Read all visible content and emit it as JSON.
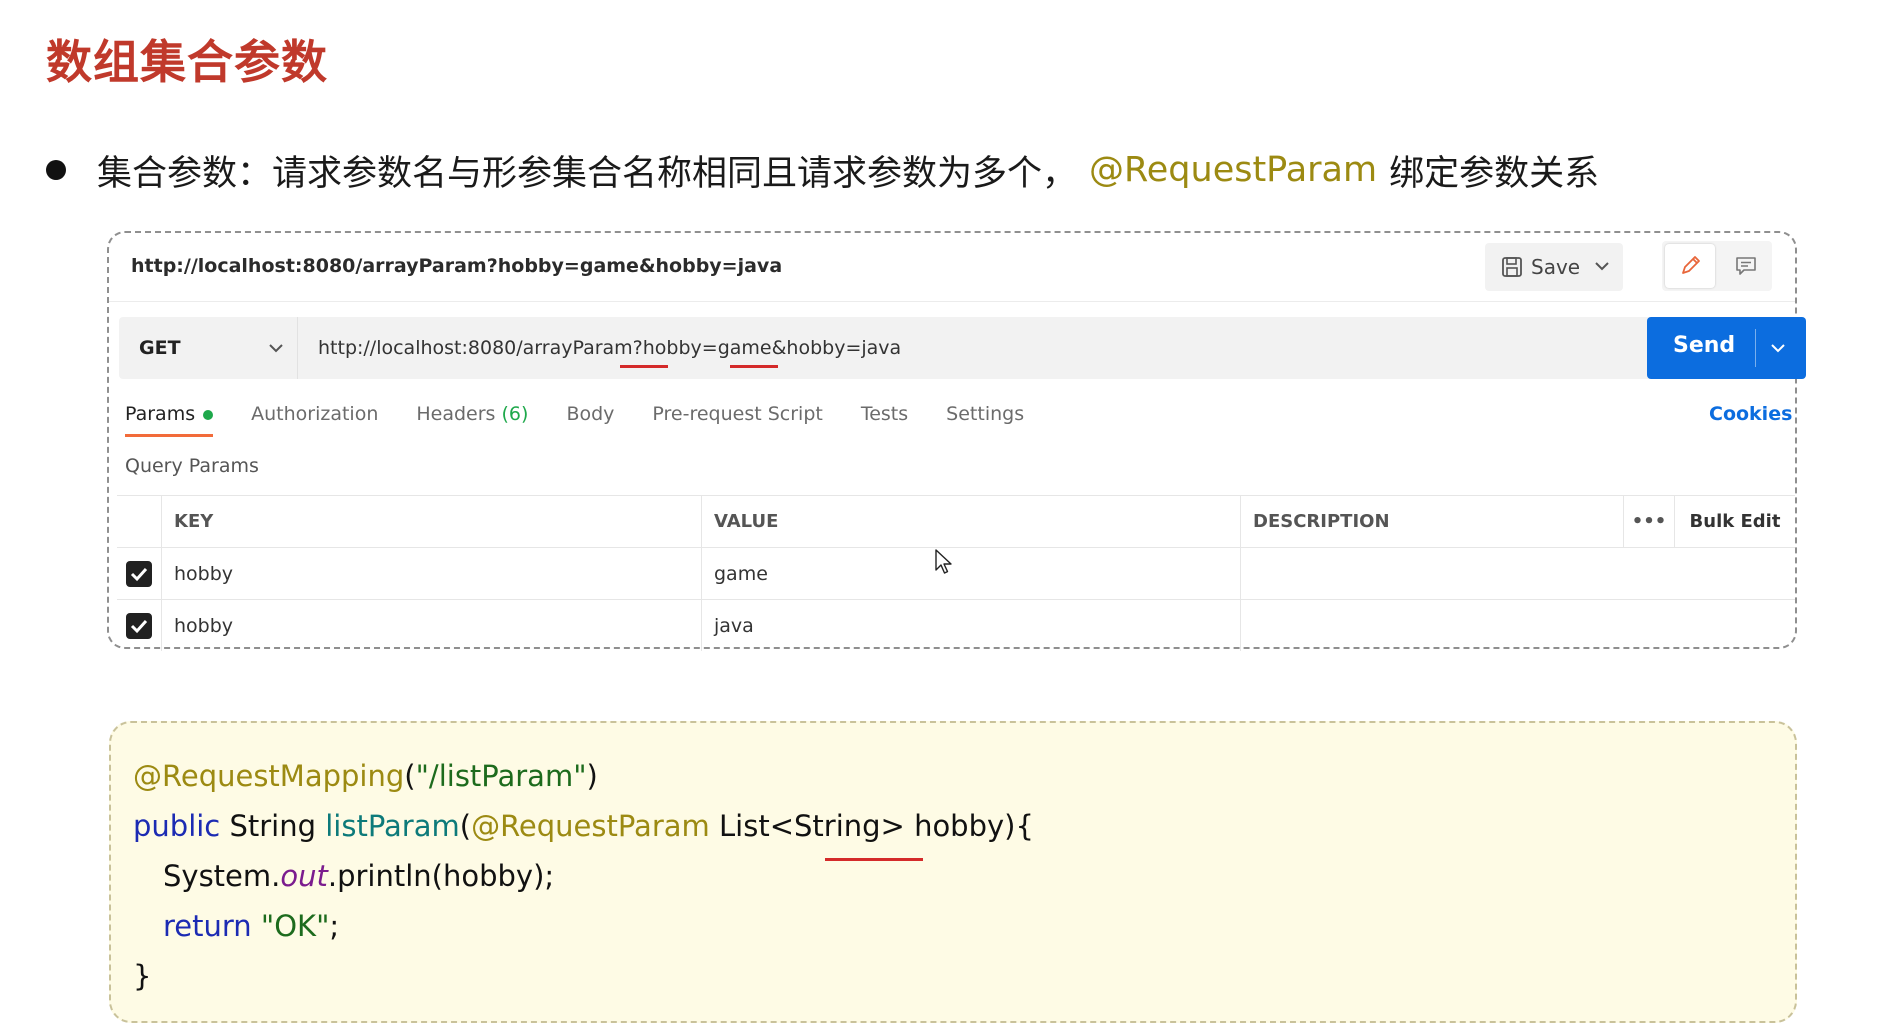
{
  "slide": {
    "title": "数组集合参数",
    "bullet_prefix": "集合参数：请求参数名与形参集合名称相同且请求参数为多个，",
    "bullet_annotation": "@RequestParam",
    "bullet_suffix": "绑定参数关系"
  },
  "postman": {
    "request_title": "http://localhost:8080/arrayParam?hobby=game&hobby=java",
    "save_label": "Save",
    "method": "GET",
    "url": "http://localhost:8080/arrayParam?hobby=game&hobby=java",
    "send_label": "Send",
    "tabs": [
      {
        "label": "Params"
      },
      {
        "label": "Authorization"
      },
      {
        "label": "Headers",
        "count": "(6)"
      },
      {
        "label": "Body"
      },
      {
        "label": "Pre-request Script"
      },
      {
        "label": "Tests"
      },
      {
        "label": "Settings"
      }
    ],
    "cookies_label": "Cookies",
    "section_label": "Query Params",
    "table": {
      "headers": {
        "key": "KEY",
        "value": "VALUE",
        "description": "DESCRIPTION",
        "more": "•••",
        "bulk_edit": "Bulk Edit"
      },
      "rows": [
        {
          "checked": true,
          "key": "hobby",
          "value": "game",
          "description": ""
        },
        {
          "checked": true,
          "key": "hobby",
          "value": "java",
          "description": ""
        }
      ]
    }
  },
  "code": {
    "line1_annotation": "@RequestMapping",
    "line1_open": "(",
    "line1_string": "\"/listParam\"",
    "line1_close": ")",
    "line2_keyword": "public",
    "line2_type": " String ",
    "line2_method": "listParam",
    "line2_open": "(",
    "line2_annotation": "@RequestParam",
    "line2_param_type": " List<String> ",
    "line2_param_name": "hobby",
    "line2_close": "){",
    "line3_obj": "System.",
    "line3_field": "out",
    "line3_call": ".println(hobby);",
    "line4_keyword": "return",
    "line4_string": " \"OK\"",
    "line4_semi": ";",
    "line5": "}"
  },
  "colors": {
    "title": "#c0392b",
    "annotation": "#9c8a12",
    "send_button": "#0c6ddf",
    "active_tab_underline": "#f26b3a",
    "params_dot": "#1ea84b",
    "highlight_underline": "#d42a2a",
    "code_background": "#fefbe5"
  }
}
